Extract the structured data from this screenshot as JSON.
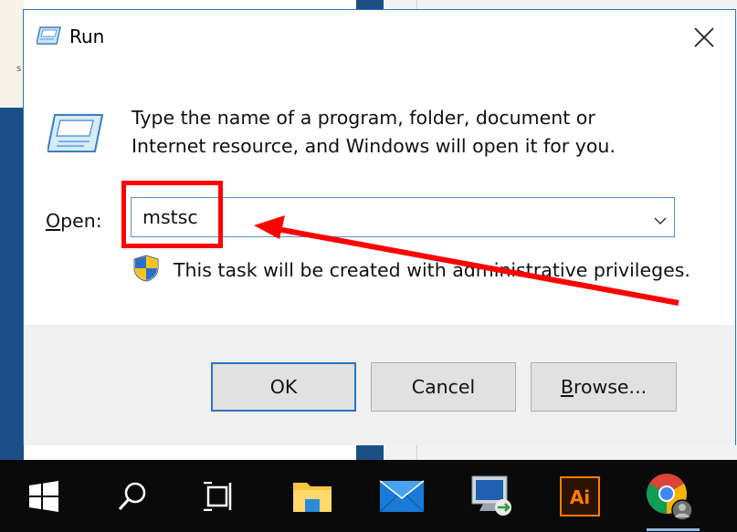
{
  "background": {
    "left_glyph": "s"
  },
  "dialog": {
    "title": "Run",
    "description_line1": "Type the name of a program, folder, document or",
    "description_line2": "Internet resource, and Windows will open it for you.",
    "open_label_underlined": "O",
    "open_label_rest": "pen:",
    "open_value": "mstsc",
    "admin_note": "This task will be created with administrative privileges.",
    "ok_label": "OK",
    "cancel_label": "Cancel",
    "browse_label_underlined": "B",
    "browse_label_rest": "rowse...",
    "accent_color": "#2b72c3"
  },
  "annotation": {
    "color": "#ff0000"
  },
  "taskbar": {
    "items": [
      {
        "icon": "windows-start-icon"
      },
      {
        "icon": "search-icon"
      },
      {
        "icon": "task-view-icon"
      },
      {
        "icon": "file-explorer-icon"
      },
      {
        "icon": "mail-icon"
      },
      {
        "icon": "remote-desktop-icon"
      },
      {
        "icon": "illustrator-icon",
        "text": "Ai"
      },
      {
        "icon": "chrome-icon"
      }
    ]
  }
}
